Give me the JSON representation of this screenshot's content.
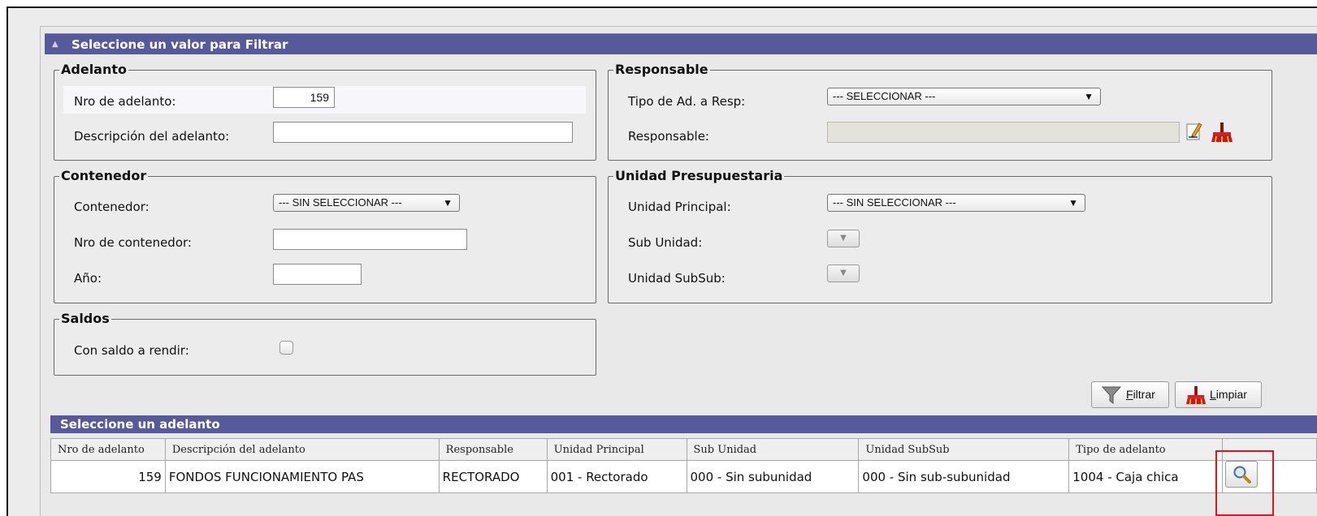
{
  "filter_panel": {
    "title": "Seleccione un valor para Filtrar",
    "collapse_icon": "collapse-up-icon"
  },
  "adelanto": {
    "legend": "Adelanto",
    "nro_label": "Nro de adelanto:",
    "nro_value": "159",
    "desc_label": "Descripción del adelanto:",
    "desc_value": ""
  },
  "responsable": {
    "legend": "Responsable",
    "tipo_label": "Tipo de Ad. a Resp:",
    "tipo_value": "--- SELECCIONAR ---",
    "resp_label": "Responsable:",
    "resp_value": "",
    "edit_icon": "pencil-edit-icon",
    "clear_icon": "broom-clear-icon"
  },
  "contenedor": {
    "legend": "Contenedor",
    "cont_label": "Contenedor:",
    "cont_value": "--- SIN SELECCIONAR ---",
    "nro_label": "Nro de contenedor:",
    "nro_value": "",
    "anio_label": "Año:",
    "anio_value": ""
  },
  "unidad": {
    "legend": "Unidad Presupuestaria",
    "principal_label": "Unidad Principal:",
    "principal_value": "--- SIN SELECCIONAR ---",
    "sub_label": "Sub Unidad:",
    "subsub_label": "Unidad SubSub:"
  },
  "saldos": {
    "legend": "Saldos",
    "check_label": "Con saldo a rendir:",
    "checked": false
  },
  "buttons": {
    "filtrar_first": "F",
    "filtrar_rest": "iltrar",
    "limpiar_first": "L",
    "limpiar_rest": "impiar"
  },
  "results": {
    "title": "Seleccione un adelanto",
    "columns": [
      "Nro de adelanto",
      "Descripción del adelanto",
      "Responsable",
      "Unidad Principal",
      "Sub Unidad",
      "Unidad SubSub",
      "Tipo de adelanto"
    ],
    "rows": [
      {
        "nro": "159",
        "descripcion": "FONDOS FUNCIONAMIENTO PAS",
        "responsable": "RECTORADO",
        "unidad_principal": "001 - Rectorado",
        "sub_unidad": "000 - Sin subunidad",
        "unidad_subsub": "000 - Sin sub-subunidad",
        "tipo": "1004 - Caja chica"
      }
    ]
  },
  "colors": {
    "header_bar": "#56599a",
    "highlight": "#e0141e"
  }
}
